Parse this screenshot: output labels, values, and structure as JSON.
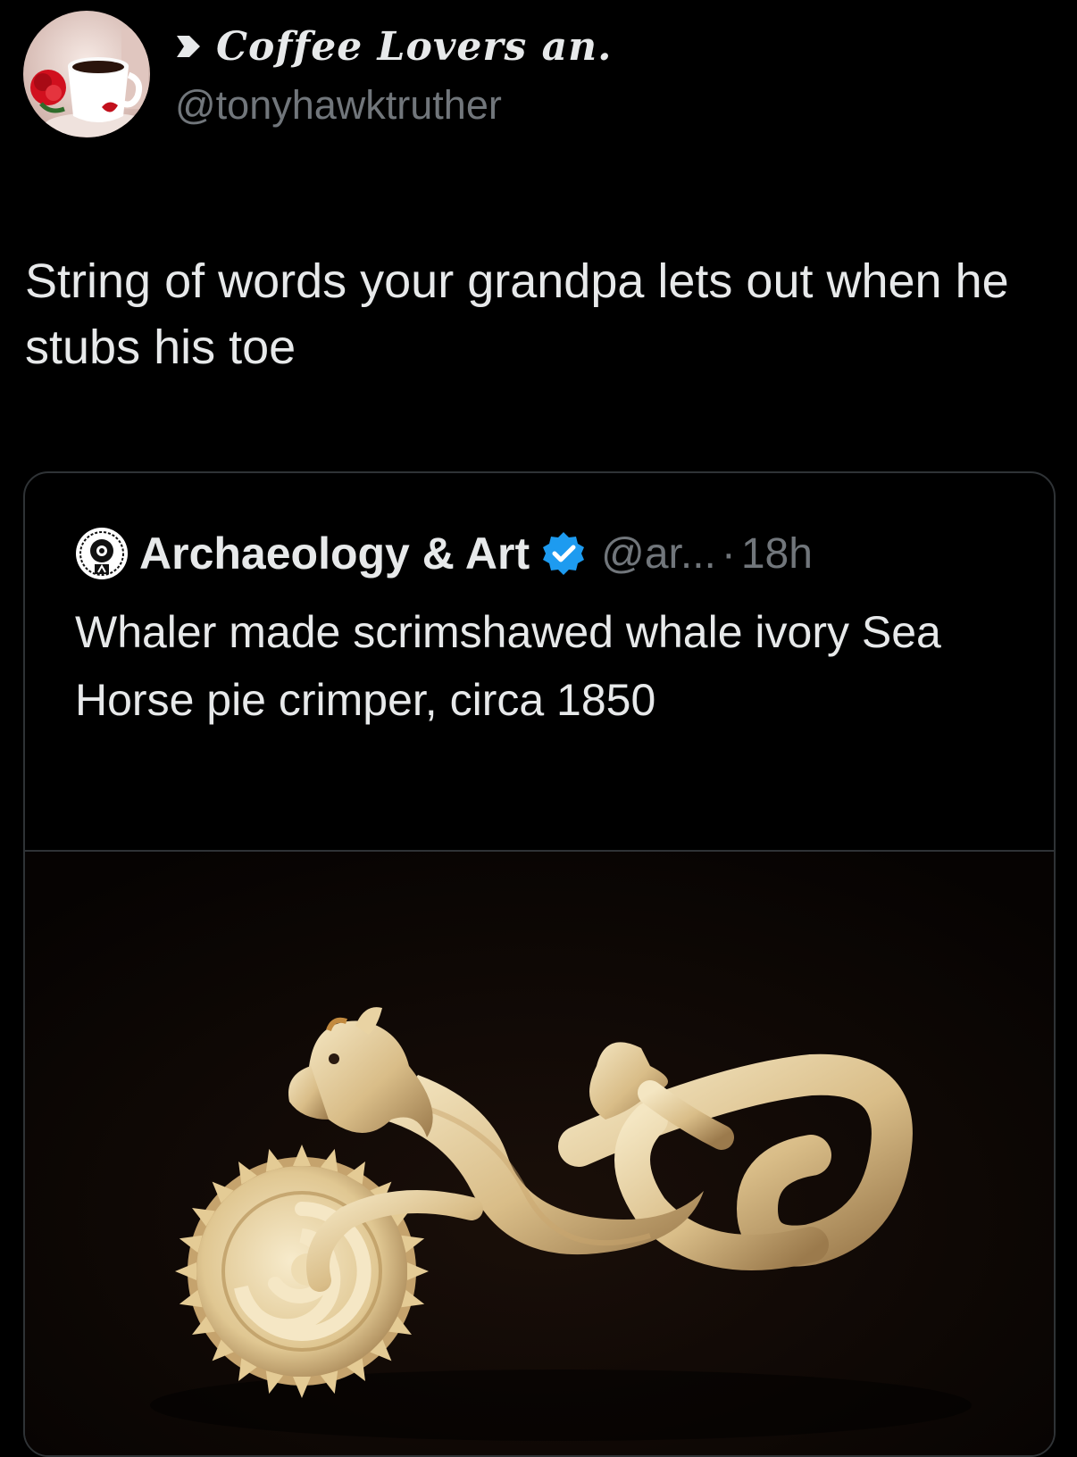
{
  "author": {
    "display_name": "Coffee Lovers an.",
    "handle": "@tonyhawktruther"
  },
  "tweet": {
    "text": "String of words your grandpa lets out when he stubs his toe"
  },
  "quoted_tweet": {
    "display_name": "Archaeology & Art",
    "handle": "@ar...",
    "separator": "·",
    "time": "18h",
    "text": "Whaler made scrimshawed whale ivory Sea Horse pie crimper, circa 1850",
    "verified_badge_color": "#1d9bf0"
  },
  "icons": {
    "name_prefix": "arrow-right-icon",
    "verified": "verified-badge-icon"
  },
  "colors": {
    "background": "#000000",
    "primary_text": "#e7e9ea",
    "secondary_text": "#71767b",
    "border": "#2f3336"
  }
}
